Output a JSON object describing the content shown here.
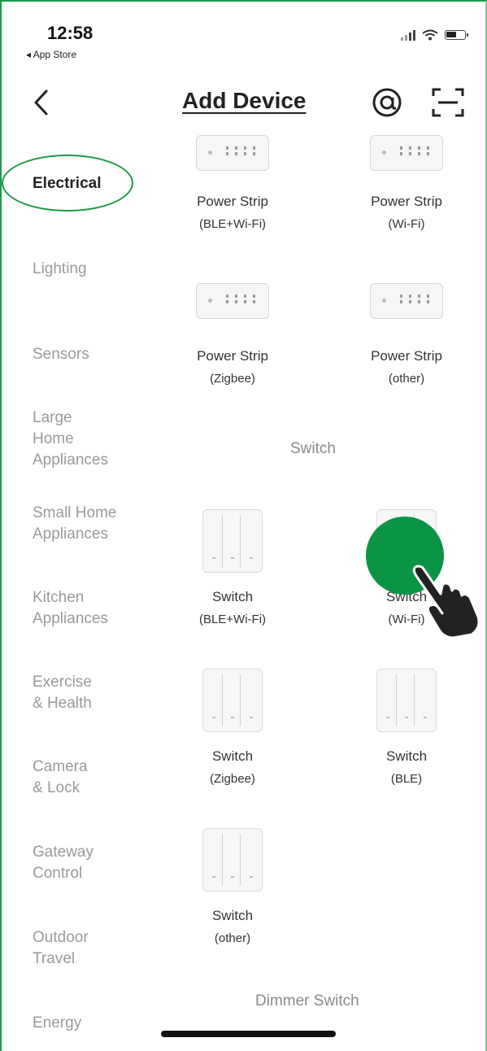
{
  "status_bar": {
    "time": "12:58",
    "back_app": "◂ App Store",
    "icons": [
      "signal-icon",
      "wifi-icon",
      "battery-icon"
    ]
  },
  "header": {
    "title": "Add Device",
    "icons": [
      "back-chevron-icon",
      "at-sign-icon",
      "scan-icon"
    ]
  },
  "categories": [
    {
      "label": "Electrical",
      "active": true
    },
    {
      "label": "Lighting"
    },
    {
      "label": "Sensors"
    },
    {
      "label": "Large\nHome\nAppliances"
    },
    {
      "label": "Small Home\nAppliances"
    },
    {
      "label": "Kitchen\nAppliances"
    },
    {
      "label": "Exercise\n& Health"
    },
    {
      "label": "Camera\n& Lock"
    },
    {
      "label": "Gateway\nControl"
    },
    {
      "label": "Outdoor\nTravel"
    },
    {
      "label": "Energy"
    }
  ],
  "power_strips": [
    {
      "line1": "Power Strip",
      "line2": "(BLE+Wi-Fi)"
    },
    {
      "line1": "Power Strip",
      "line2": "(Wi-Fi)"
    },
    {
      "line1": "Power Strip",
      "line2": "(Zigbee)"
    },
    {
      "line1": "Power Strip",
      "line2": "(other)"
    }
  ],
  "switch_section_title": "Switch",
  "switches": [
    {
      "line1": "Switch",
      "line2": "(BLE+Wi-Fi)"
    },
    {
      "line1": "Switch",
      "line2": "(Wi-Fi)"
    },
    {
      "line1": "Switch",
      "line2": "(Zigbee)"
    },
    {
      "line1": "Switch",
      "line2": "(BLE)"
    },
    {
      "line1": "Switch",
      "line2": "(other)"
    }
  ],
  "dimmer_section_title": "Dimmer Switch",
  "colors": {
    "highlight": "#1a9a48",
    "tap_indicator": "#0a9444",
    "inactive_text": "#9a9a9a"
  }
}
